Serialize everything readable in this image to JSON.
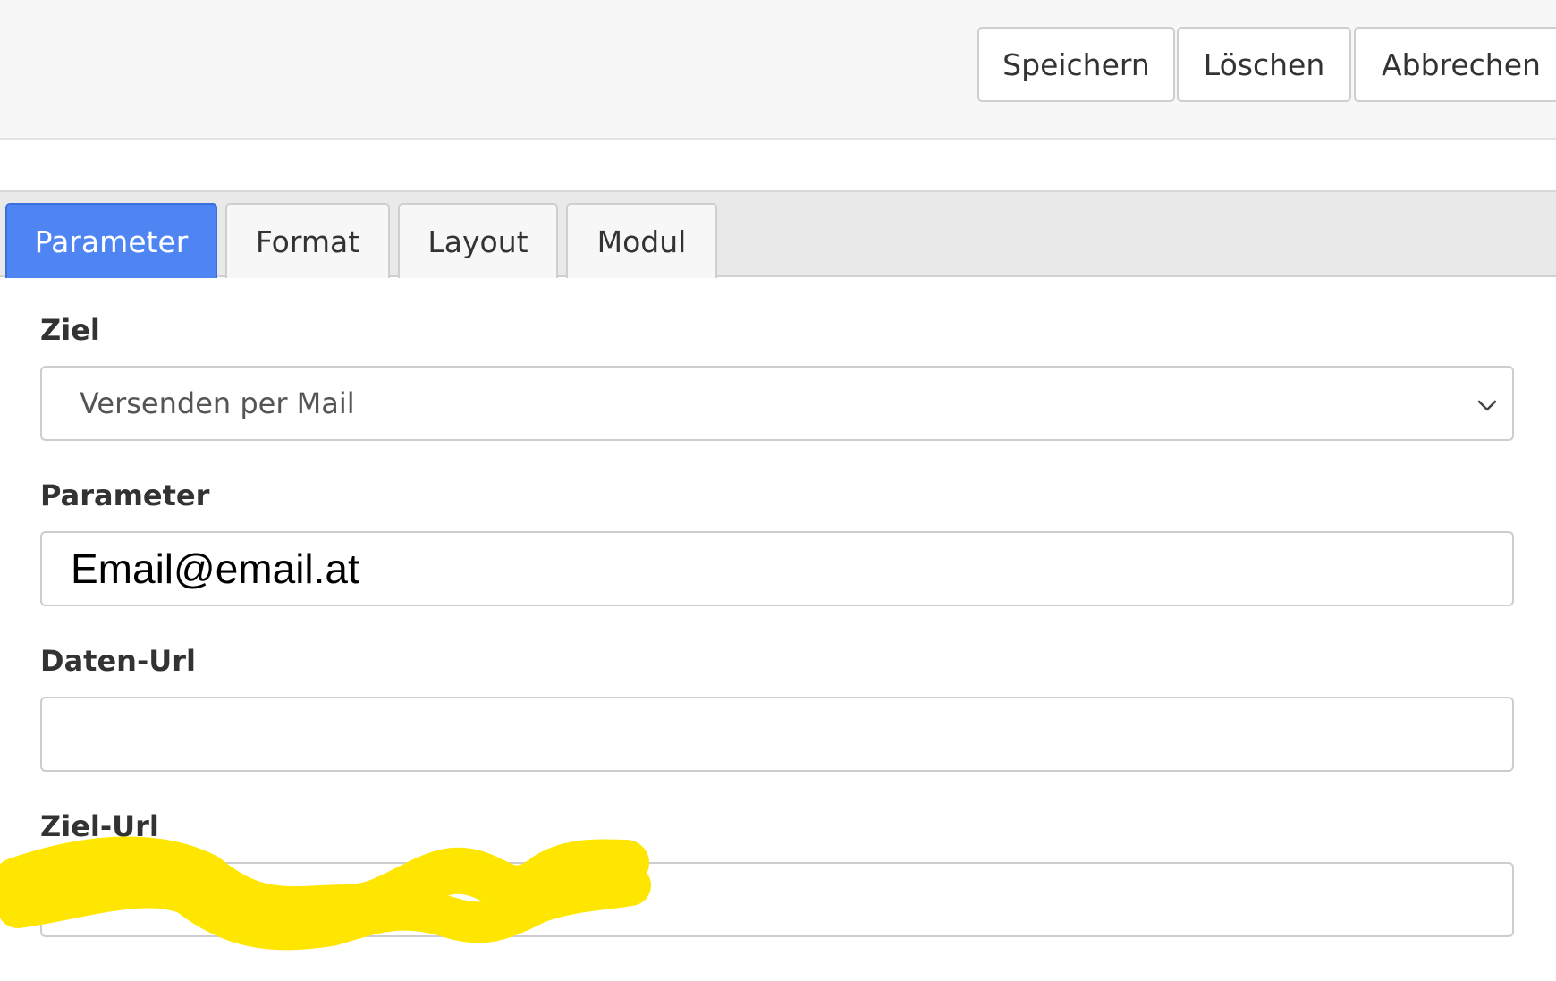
{
  "toolbar": {
    "save_label": "Speichern",
    "delete_label": "Löschen",
    "cancel_label": "Abbrechen"
  },
  "tabs": [
    {
      "label": "Parameter",
      "active": true
    },
    {
      "label": "Format",
      "active": false
    },
    {
      "label": "Layout",
      "active": false
    },
    {
      "label": "Modul",
      "active": false
    }
  ],
  "form": {
    "ziel": {
      "label": "Ziel",
      "selected": "Versenden per Mail"
    },
    "parameter": {
      "label": "Parameter",
      "value": "Email@email.at"
    },
    "daten_url": {
      "label": "Daten-Url",
      "value": ""
    },
    "ziel_url": {
      "label": "Ziel-Url",
      "value": "/"
    }
  },
  "colors": {
    "active_tab": "#4e85f3",
    "highlight": "#ffe600"
  },
  "icons": {
    "select_arrow": "chevron-down-icon"
  }
}
